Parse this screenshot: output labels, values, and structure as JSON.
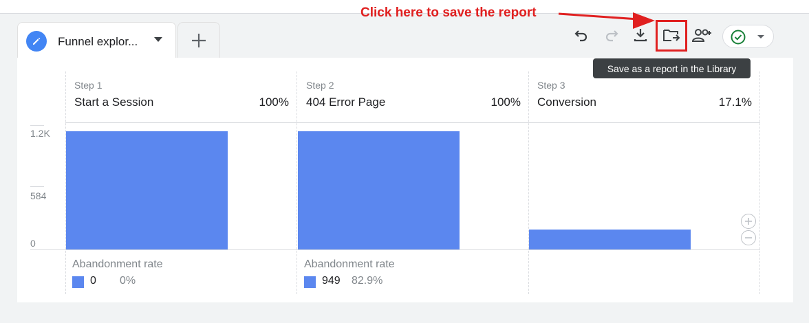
{
  "tabs": [
    {
      "label": "Funnel explor..."
    }
  ],
  "toolbar": {
    "buttons": [
      "undo-icon",
      "redo-icon",
      "download-icon",
      "save-to-library-icon",
      "share-icon"
    ],
    "status": "check-circle-icon"
  },
  "tooltip": "Save as a report in the Library",
  "annotation": "Click here to save the report",
  "chart_data": {
    "type": "bar",
    "categories": [
      "Start a Session",
      "404 Error Page",
      "Conversion"
    ],
    "step_labels": [
      "Step 1",
      "Step 2",
      "Step 3"
    ],
    "percents": [
      "100%",
      "100%",
      "17.1%"
    ],
    "values": [
      1110,
      1110,
      190
    ],
    "y_ticks": [
      "1.2K",
      "584",
      "0"
    ],
    "ylim": [
      0,
      1168
    ],
    "abandonment": [
      {
        "label": "Abandonment rate",
        "count": "0",
        "rate": "0%"
      },
      {
        "label": "Abandonment rate",
        "count": "949",
        "rate": "82.9%"
      }
    ],
    "bar_color": "#5b87ef"
  },
  "colors": {
    "accent": "#4285f4",
    "annotation": "#e02020",
    "status": "#188038"
  }
}
